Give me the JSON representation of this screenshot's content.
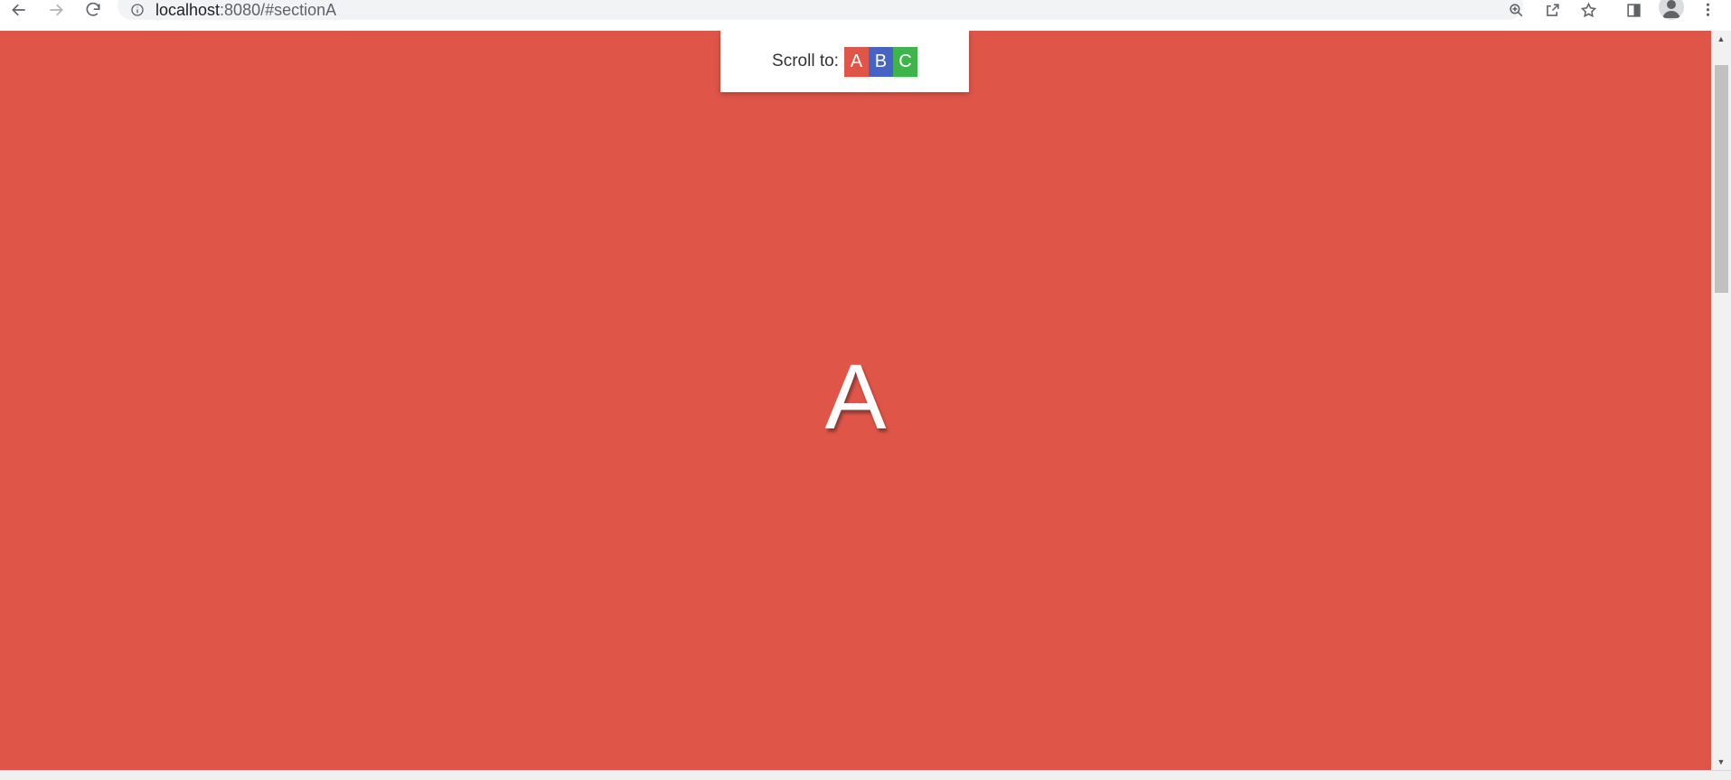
{
  "browser": {
    "url_host": "localhost",
    "url_path": ":8080/#sectionA",
    "icons": {
      "back": "arrow-left",
      "forward": "arrow-right",
      "reload": "refresh",
      "info": "info-circle",
      "zoom": "zoom-in",
      "share": "share",
      "bookmark": "star",
      "side_panel": "side-panel",
      "profile": "avatar",
      "menu": "kebab"
    }
  },
  "page": {
    "background_color": "#df5548",
    "scroll_label": "Scroll to:",
    "nav_buttons": [
      {
        "label": "A",
        "color": "#df5548"
      },
      {
        "label": "B",
        "color": "#4664c4"
      },
      {
        "label": "C",
        "color": "#3db54a"
      }
    ],
    "section_letter": "A"
  }
}
